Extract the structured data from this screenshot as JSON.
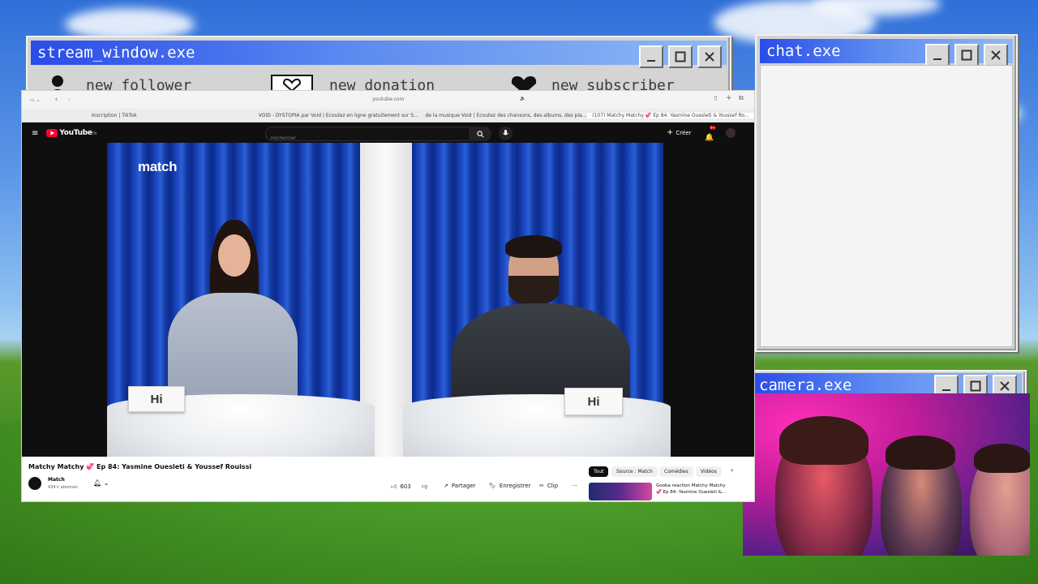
{
  "desktop": {
    "colors": {
      "sky": "#4f8de6",
      "grass": "#3f8a1f",
      "title_bar": "#2a4ce8"
    }
  },
  "stream_window": {
    "title": "stream_window.exe",
    "notifications": [
      {
        "icon": "person-icon",
        "label": "new follower"
      },
      {
        "icon": "heart-money-icon",
        "label": "new donation"
      },
      {
        "icon": "heart-icon",
        "label": "new subscriber"
      }
    ]
  },
  "chat_window": {
    "title": "chat.exe"
  },
  "camera_window": {
    "title": "camera.exe"
  },
  "browser": {
    "url": "youtube.com",
    "tabs": [
      "Inscription | TikTok",
      "VOID - DYSTOPIA par Void | Écoutez en ligne gratuitement sur Soun...",
      "de la musique Void | Écoutez des chansons, des albums, des playlis...",
      "(107) Matchy Matchy 💞 Ep 84: Yasmine Ouesleti & Youssef Ro..."
    ]
  },
  "youtube": {
    "logo_text": "YouTube",
    "logo_sup": "TN",
    "search_placeholder": "Rechercher",
    "create_label": "Créer",
    "notif_count": "9+",
    "video": {
      "brand": "match",
      "card_left": "Hi",
      "card_right": "Hi"
    },
    "title": "Matchy Matchy 💞 Ep 84: Yasmine Ouesleti & Youssef Rouissi",
    "channel": "Match",
    "subscribers": "434 k abonnés",
    "likes": "603",
    "share_label": "Partager",
    "save_label": "Enregistrer",
    "clip_label": "Clip",
    "more_label": "···",
    "chips": [
      "Tout",
      "Source : Match",
      "Comédies",
      "Vidéos"
    ],
    "suggested": {
      "title_line1": "Gooba reaction Matchy Matchy",
      "title_line2": "💞 Ep 84: Yasmine Ouesleti &..."
    }
  }
}
